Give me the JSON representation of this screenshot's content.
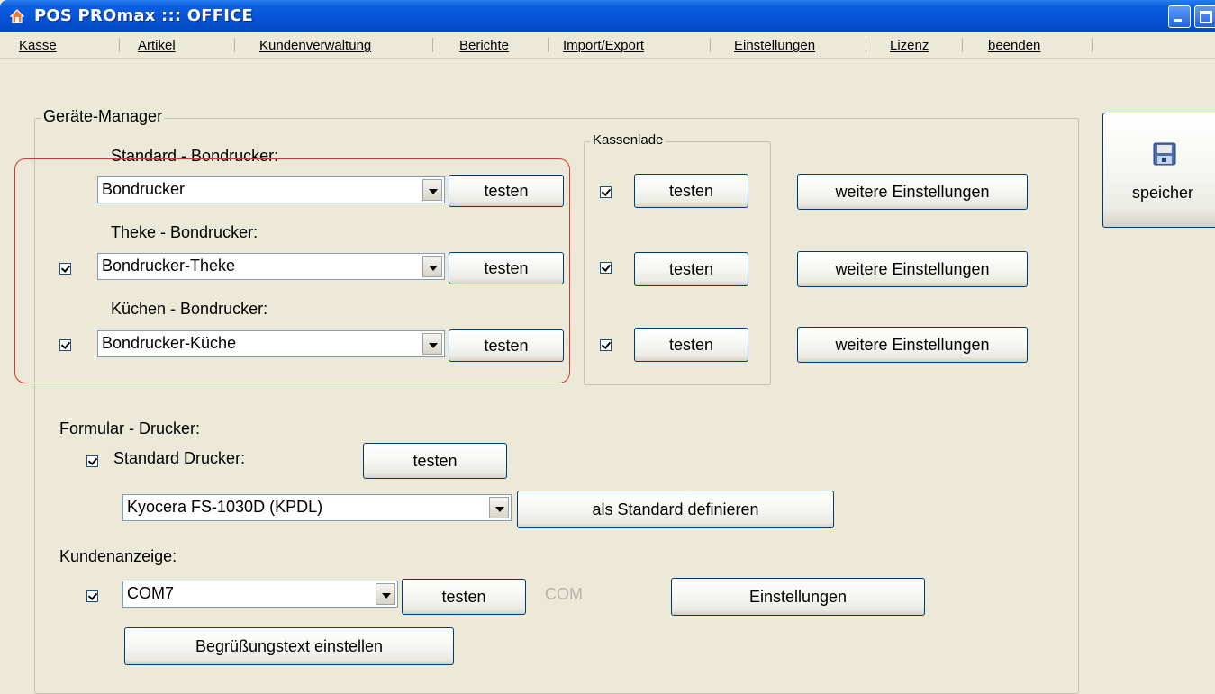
{
  "window": {
    "title": "POS PROmax ::: OFFICE"
  },
  "menu": [
    "Kasse",
    "Artikel",
    "Kundenverwaltung",
    "Berichte",
    "Import/Export",
    "Einstellungen",
    "Lizenz",
    "beenden"
  ],
  "geraete": {
    "group_title": "Geräte-Manager",
    "standard_label": "Standard - Bondrucker:",
    "standard_value": "Bondrucker",
    "theke_label": "Theke - Bondrucker:",
    "theke_value": "Bondrucker-Theke",
    "theke_checked": true,
    "kuechen_label": "Küchen - Bondrucker:",
    "kuechen_value": "Bondrucker-Küche",
    "kuechen_checked": true,
    "test_label": "testen"
  },
  "kassenlade": {
    "group_title": "Kassenlade",
    "rows_checked": [
      true,
      true,
      true
    ],
    "test_label": "testen"
  },
  "weitere_label": "weitere Einstellungen",
  "save_label": "speicher",
  "formular": {
    "label": "Formular - Drucker:",
    "standard_label": "Standard Drucker:",
    "standard_checked": true,
    "test_label": "testen",
    "printer_value": "Kyocera FS-1030D (KPDL)",
    "define_label": "als Standard definieren"
  },
  "kundenanzeige": {
    "label": "Kundenanzeige:",
    "checked": true,
    "port_value": "COM7",
    "test_label": "testen",
    "com_label": "COM",
    "settings_label": "Einstellungen",
    "greeting_label": "Begrüßungstext einstellen"
  }
}
